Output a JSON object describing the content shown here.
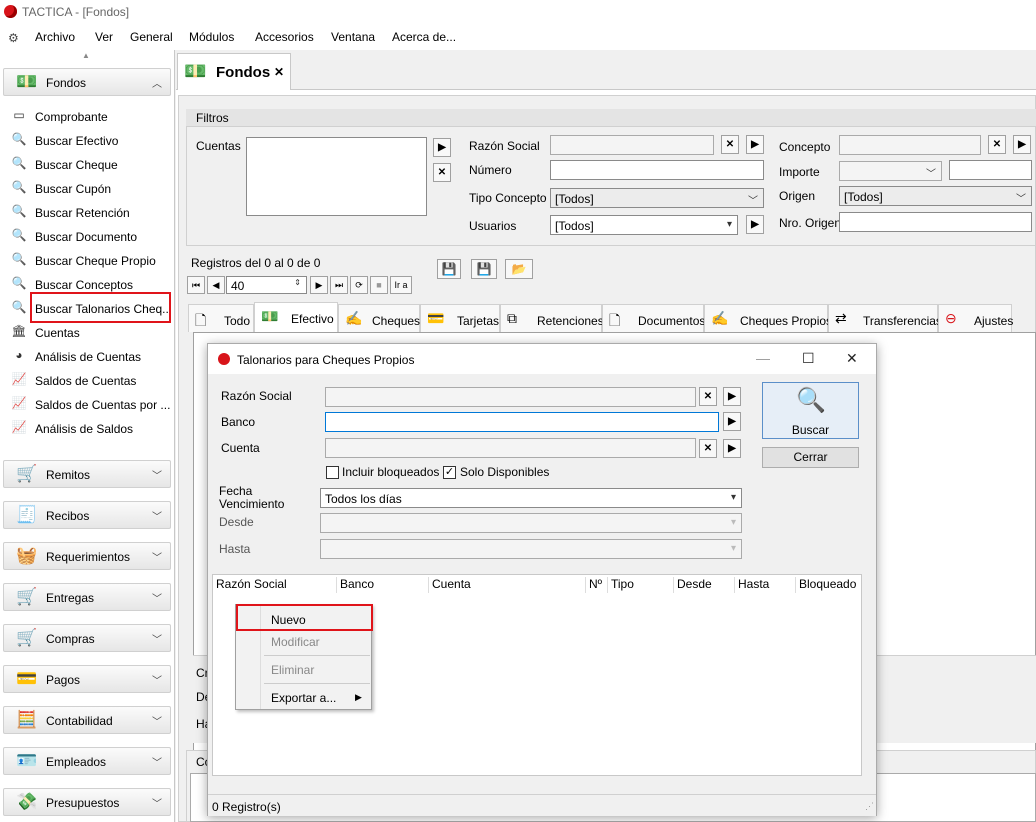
{
  "window": {
    "title": "TACTICA - [Fondos]"
  },
  "menu": [
    "Archivo",
    "Ver",
    "General",
    "Módulos",
    "Accesorios",
    "Ventana",
    "Acerca de..."
  ],
  "sidebar": {
    "fondos_group": "Fondos",
    "items": [
      "Comprobante",
      "Buscar Efectivo",
      "Buscar Cheque",
      "Buscar Cupón",
      "Buscar Retención",
      "Buscar Documento",
      "Buscar Cheque Propio",
      "Buscar Conceptos",
      "Buscar Talonarios Cheq...",
      "Cuentas",
      "Análisis de Cuentas",
      "Saldos de Cuentas",
      "Saldos de Cuentas por ...",
      "Análisis de Saldos"
    ],
    "groups": [
      "Remitos",
      "Recibos",
      "Requerimientos",
      "Entregas",
      "Compras",
      "Pagos",
      "Contabilidad",
      "Empleados",
      "Presupuestos"
    ]
  },
  "doc_tab": {
    "label": "Fondos"
  },
  "filters": {
    "title": "Filtros",
    "cuentas": "Cuentas",
    "razon_social": "Razón Social",
    "numero": "Número",
    "tipo_concepto": "Tipo Concepto",
    "tipo_concepto_value": "[Todos]",
    "usuarios": "Usuarios",
    "usuarios_value": "[Todos]",
    "concepto": "Concepto",
    "importe": "Importe",
    "origen": "Origen",
    "origen_value": "[Todos]",
    "nro_origen": "Nro. Origen"
  },
  "records": {
    "text": "Registros del 0 al 0 de 0",
    "page_size": "40",
    "goto": "Ir a"
  },
  "tabs": [
    "Todo",
    "Efectivo",
    "Cheques",
    "Tarjetas",
    "Retenciones",
    "Documentos",
    "Cheques Propios",
    "Transferencias",
    "Ajustes"
  ],
  "bg_labels": {
    "cr": "Cr",
    "de": "De",
    "ha": "Ha",
    "co": "Co"
  },
  "dialog": {
    "title": "Talonarios para Cheques Propios",
    "razon_social": "Razón Social",
    "banco": "Banco",
    "cuenta": "Cuenta",
    "incluir_bloqueados": "Incluir bloqueados",
    "solo_disponibles": "Solo Disponibles",
    "fecha_vencimiento_1": "Fecha",
    "fecha_vencimiento_2": "Vencimiento",
    "fecha_value": "Todos los días",
    "desde": "Desde",
    "hasta": "Hasta",
    "buscar": "Buscar",
    "cerrar": "Cerrar",
    "columns": [
      "Razón Social",
      "Banco",
      "Cuenta",
      "Nº",
      "Tipo",
      "Desde",
      "Hasta",
      "Bloqueado"
    ],
    "status": "0 Registro(s)"
  },
  "context_menu": {
    "nuevo": "Nuevo",
    "modificar": "Modificar",
    "eliminar": "Eliminar",
    "exportar": "Exportar a..."
  }
}
